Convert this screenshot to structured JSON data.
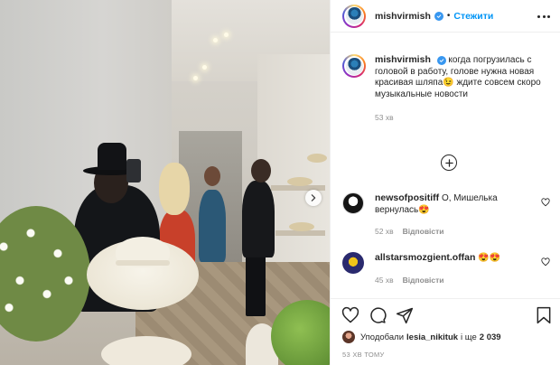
{
  "colors": {
    "follow": "#0095f6",
    "verified": "#3897f0",
    "muted_text": "#8e8e8e",
    "primary_text": "#262626"
  },
  "photo": {
    "description_icon": "next-photo-arrow-icon"
  },
  "header": {
    "username": "mishvirmish",
    "separator": "•",
    "follow_label": "Стежити",
    "more_icon": "more-options-icon"
  },
  "caption": {
    "username": "mishvirmish",
    "text": "когда погрузилась с головой в работу, голове нужна новая красивая шляпа😉 ждите совсем скоро музыкальные новости",
    "time": "53 хв"
  },
  "load_more_icon": "plus-circle-icon",
  "comments": [
    {
      "username": "newsofpositiff",
      "text": "О, Мишелька вернулась😍",
      "time": "52 хв",
      "reply_label": "Відповісти"
    },
    {
      "username": "allstarsmozgient.offan",
      "text": "😍😍",
      "time": "45 хв",
      "reply_label": "Відповісти"
    }
  ],
  "actions": {
    "like_icon": "heart-icon",
    "comment_icon": "comment-icon",
    "share_icon": "share-icon",
    "save_icon": "bookmark-icon"
  },
  "likes": {
    "prefix": "Уподобали",
    "user": "lesia_nikituk",
    "middle": "і ще",
    "count": "2 039"
  },
  "post_time": "53 ХВ ТОМУ"
}
